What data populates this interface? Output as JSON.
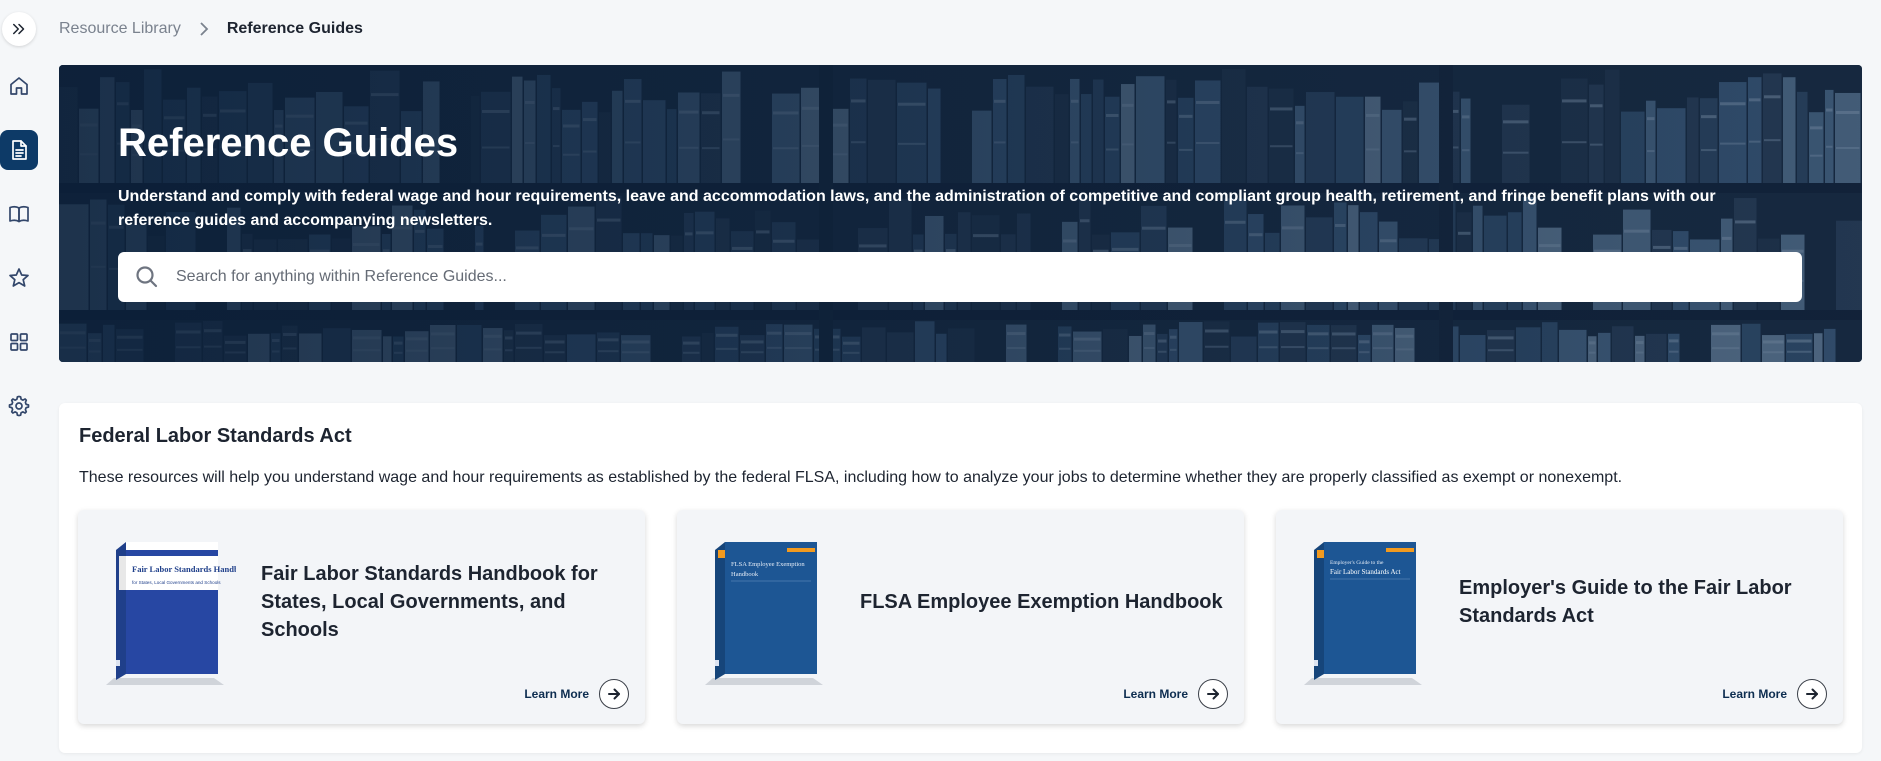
{
  "sidebar": {
    "items": [
      {
        "icon": "home-icon",
        "active": false
      },
      {
        "icon": "document-icon",
        "active": true
      },
      {
        "icon": "book-icon",
        "active": false
      },
      {
        "icon": "star-icon",
        "active": false
      },
      {
        "icon": "grid-icon",
        "active": false
      },
      {
        "icon": "gear-icon",
        "active": false
      }
    ],
    "accent_color": "#0d3a67"
  },
  "breadcrumb": {
    "parent": "Resource Library",
    "current": "Reference Guides"
  },
  "hero": {
    "title": "Reference Guides",
    "description": "Understand and comply with federal wage and hour requirements, leave and accommodation laws, and the administration of competitive and compliant group health, retirement, and fringe benefit plans with our reference guides and accompanying newsletters.",
    "search_placeholder": "Search for anything within Reference Guides..."
  },
  "section": {
    "title": "Federal Labor Standards Act",
    "description": "These resources will help you understand wage and hour requirements as established by the federal FLSA, including how to analyze your jobs to determine whether they are properly classified as exempt or nonexempt.",
    "cards": [
      {
        "title": "Fair Labor Standards Handbook for States, Local Governments, and Schools",
        "cover_title": "Fair Labor Standards Handbook",
        "cover_subtitle": "for States, Local Governments and Schools",
        "learn_more": "Learn More"
      },
      {
        "title": "FLSA Employee Exemption Handbook",
        "cover_title": "FLSA Employee Exemption",
        "cover_subtitle": "Handbook",
        "learn_more": "Learn More"
      },
      {
        "title": "Employer's Guide to the Fair Labor Standards Act",
        "cover_title": "Employer's Guide to the",
        "cover_subtitle": "Fair Labor Standards Act",
        "learn_more": "Learn More"
      }
    ]
  }
}
